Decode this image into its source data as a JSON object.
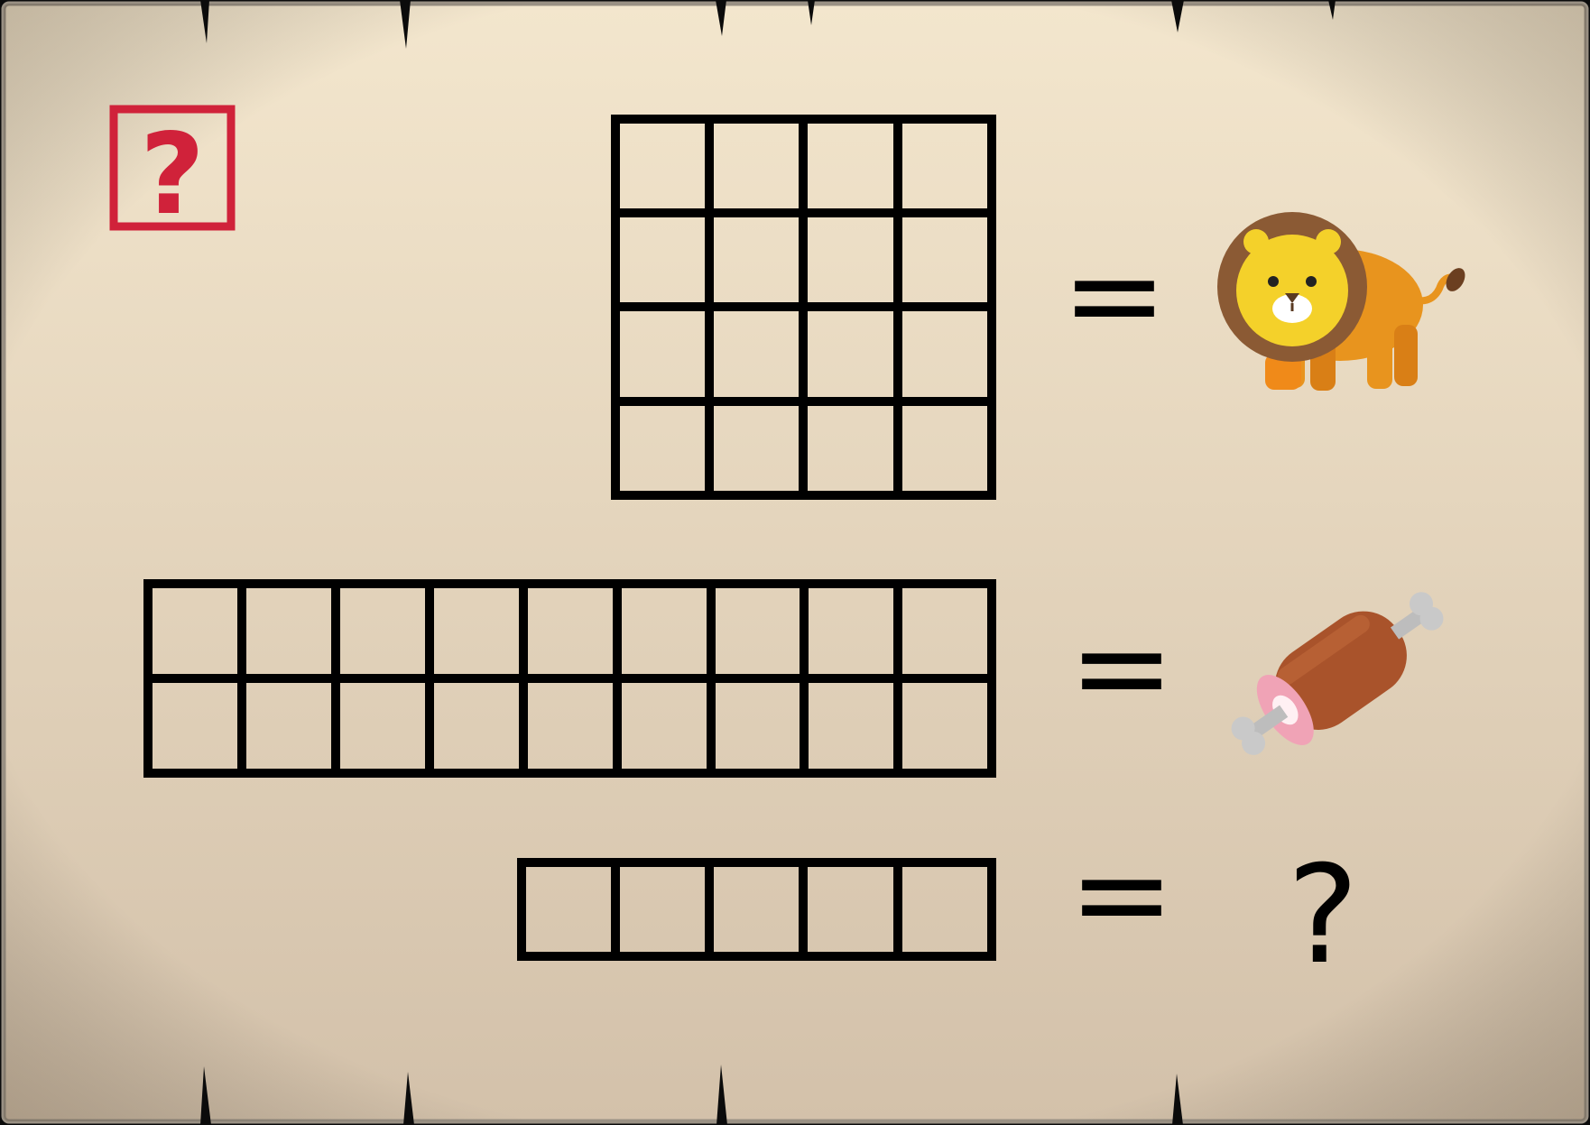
{
  "puzzle": {
    "stamp": {
      "icon": "question-stamp-icon",
      "text": "?",
      "color": "#d0223a"
    },
    "rows": [
      {
        "grid": {
          "cols": 4,
          "rows": 4
        },
        "equals": "=",
        "answer": {
          "icon": "lion-icon"
        }
      },
      {
        "grid": {
          "cols": 9,
          "rows": 2
        },
        "equals": "=",
        "answer": {
          "icon": "meat-icon"
        }
      },
      {
        "grid": {
          "cols": 5,
          "rows": 1
        },
        "equals": "=",
        "answer": {
          "icon": "question-mark",
          "text": "?"
        }
      }
    ]
  },
  "colors": {
    "parchment_top": "#f3e6cd",
    "parchment_bottom": "#d5c3ac",
    "grid_line": "#000000",
    "stamp_red": "#d0223a"
  }
}
